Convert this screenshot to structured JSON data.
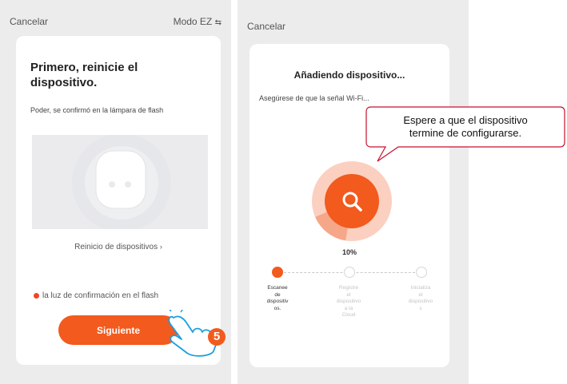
{
  "left_screen": {
    "cancel_label": "Cancelar",
    "mode_label": "Modo EZ",
    "mode_icon": "swap-arrows-icon",
    "title_line1": "Primero, reinicie el",
    "title_line2": "dispositivo.",
    "power_note": "Poder, se confirmó en la lámpara de flash",
    "reset_link": "Reinicio de dispositivos",
    "confirm_label": "la luz de confirmación en el flash",
    "next_button": "Siguiente",
    "step_number": "5",
    "accent_color": "#f25a1e"
  },
  "right_screen": {
    "cancel_label": "Cancelar",
    "title": "Añadiendo dispositivo...",
    "wifi_note": "Asegúrese de que la señal Wi-Fi...",
    "progress_percent": 10,
    "progress_text": "10%",
    "steps": [
      {
        "line1": "Escanee",
        "line2": "de",
        "line3": "dispositiv",
        "line4": "os.",
        "active": true
      },
      {
        "line1": "Registre",
        "line2": "el",
        "line3": "dispositivo",
        "line4": "a la",
        "line5": "Cloud",
        "active": false
      },
      {
        "line1": "Inicializa",
        "line2": "el",
        "line3": "dispositivo",
        "line4": "s",
        "active": false
      }
    ]
  },
  "callout": {
    "line1": "Espere a que el dispositivo",
    "line2": "termine de configurarse."
  }
}
